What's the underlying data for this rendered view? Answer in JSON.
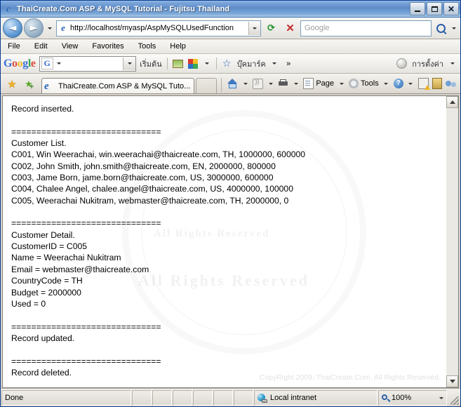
{
  "window": {
    "title": "ThaiCreate.Com ASP & MySQL Tutorial - Fujitsu Thailand",
    "minimize_label": "Minimize",
    "maximize_label": "Maximize",
    "close_label": "Close"
  },
  "address_bar": {
    "back_label": "Back",
    "forward_label": "Forward",
    "url": "http://localhost/myasp/AspMySQLUsedFunction",
    "refresh_label": "Refresh",
    "stop_label": "Stop",
    "search_placeholder": "Google",
    "search_value": ""
  },
  "menu": {
    "items": [
      "File",
      "Edit",
      "View",
      "Favorites",
      "Tools",
      "Help"
    ]
  },
  "google_toolbar": {
    "logo": "Google",
    "search_value": "",
    "start_label": "เริ่มต้น",
    "bookmarks_label": "บุ๊คมาร์ค",
    "more_label": "»",
    "settings_label": "การตั้งค่า"
  },
  "tabs": {
    "favorites_label": "Favorites",
    "add_favorites_label": "Add to Favorites",
    "items": [
      {
        "title": "ThaiCreate.Com ASP & MySQL Tuto...",
        "active": true
      }
    ]
  },
  "command_bar": {
    "home_label": "Home",
    "feeds_label": "Feeds",
    "print_label": "Print",
    "page_label": "Page",
    "tools_label": "Tools",
    "help_label": "Help",
    "misc1_label": "Research",
    "misc2_label": "Toolbar",
    "misc3_label": "Messenger"
  },
  "content": {
    "body_text": "Record inserted.\n\n==============================\nCustomer List.\nC001, Win Weerachai, win.weerachai@thaicreate.com, TH, 1000000, 600000\nC002, John Smith, john.smith@thaicreate.com, EN, 2000000, 800000\nC003, Jame Born, jame.born@thaicreate.com, US, 3000000, 600000\nC004, Chalee Angel, chalee.angel@thaicreate.com, US, 4000000, 100000\nC005, Weerachai Nukitram, webmaster@thaicreate.com, TH, 2000000, 0\n\n==============================\nCustomer Detail.\nCustomerID = C005\nName = Weerachai Nukitram\nEmail = webmaster@thaicreate.com\nCountryCode = TH\nBudget = 2000000\nUsed = 0\n\n==============================\nRecord updated.\n\n==============================\nRecord deleted.",
    "copyright": "CopyRight 2009. ThaiCreate.Com. All Rights Reserved.",
    "watermark_center": "All Rights Reserved",
    "watermark_top": "All Rights Reserved"
  },
  "status_bar": {
    "status": "Done",
    "zone": "Local intranet",
    "zoom": "100%"
  }
}
